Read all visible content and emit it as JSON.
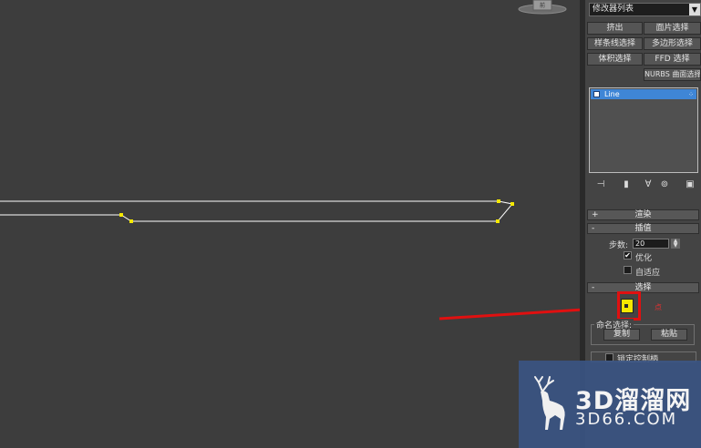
{
  "modifier_list": {
    "label": "修改器列表",
    "arrow": "▼"
  },
  "modifier_buttons": [
    {
      "label": "挤出"
    },
    {
      "label": "面片选择"
    },
    {
      "label": "样条线选择"
    },
    {
      "label": "多边形选择"
    },
    {
      "label": "体积选择"
    },
    {
      "label": "FFD 选择"
    },
    {
      "label": "NURBS 曲面选择"
    }
  ],
  "stack": {
    "item": "Line"
  },
  "rollouts": {
    "render": {
      "sign": "+",
      "title": "渲染"
    },
    "interpolation": {
      "sign": "-",
      "title": "插值"
    },
    "selection": {
      "sign": "-",
      "title": "选择"
    }
  },
  "interpolation": {
    "steps_label": "步数:",
    "steps_value": "20",
    "optimize_label": "优化",
    "optimize_checked": true,
    "adaptive_label": "自适应",
    "adaptive_checked": false
  },
  "selection": {
    "vertex_label": "点",
    "named_selection_label": "命名选择:",
    "copy_label": "复制",
    "paste_label": "粘贴",
    "lock_handles_label": "锁定控制柄"
  },
  "viewport": {
    "view_cube_label": "前"
  },
  "watermark": {
    "main": "3D溜溜网",
    "sub": "3D66.COM"
  },
  "colors": {
    "viewport_bg": "#3d3d3d",
    "spline": "#ffffff",
    "vertex": "#f5e800",
    "highlight": "#e01010",
    "selected_item": "#3f86d6"
  }
}
